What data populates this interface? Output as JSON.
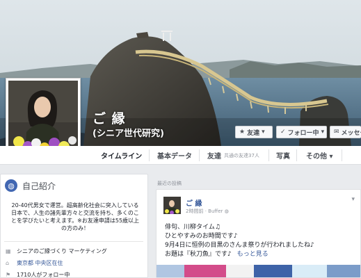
{
  "profile": {
    "name": "ご 縁",
    "subtitle": "(シニア世代研究)"
  },
  "cover_buttons": [
    {
      "icon": "★",
      "label": "友達",
      "caret": "▾"
    },
    {
      "icon": "✓",
      "label": "フォロー中",
      "caret": "▾"
    },
    {
      "icon": "✉",
      "label": "メッセージ"
    }
  ],
  "nav": {
    "tabs": [
      "タイムライン",
      "基本データ",
      "友達",
      "写真",
      "その他 ▾"
    ],
    "friends_count": "共通の友達37人"
  },
  "intro": {
    "title": "自己紹介",
    "text": "20-40代男女で運営。超高齢化社会に突入している日本で、人生の諸先輩方々と交流を持ち、多くのことを学びたいと考えます。※お友達申請は55歳以上の方のみ！",
    "rows": [
      {
        "icon": "▦",
        "text": "シニアのご縁づくり マーケティング"
      },
      {
        "icon": "⌂",
        "text": "東京都 中央区在住"
      },
      {
        "icon": "⚑",
        "text": "1710人がフォロー中"
      }
    ]
  },
  "timeline": {
    "recent_label": "最近の投稿",
    "post": {
      "author": "ご 縁",
      "time": "2時間前",
      "via": "Buffer",
      "lines": [
        "俳句、川柳タイム♫",
        "ひとやすみのお時間です♪",
        "9月4日に恒例の目黒のさんま祭りが行われましたね♪",
        "お題は『秋刀魚』です♪"
      ],
      "more_label": "もっと見る"
    }
  },
  "colors": {
    "link": "#365899",
    "brand": "#4267b2",
    "background": "#e9ebee"
  }
}
